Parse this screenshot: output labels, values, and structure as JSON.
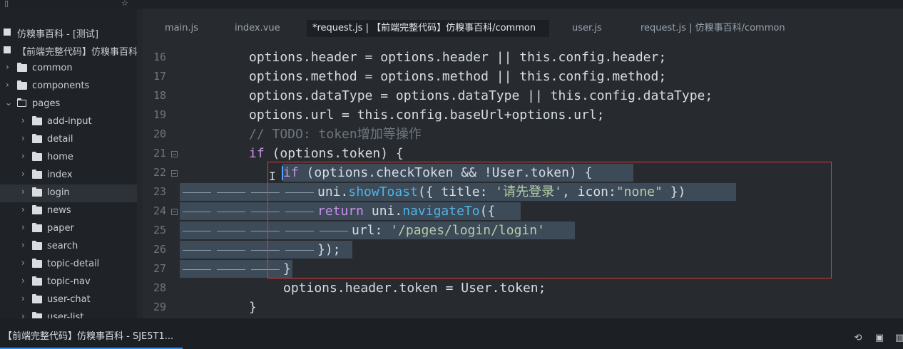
{
  "sidebar": {
    "projects": [
      {
        "label": "仿糗事百科 - [测试]"
      },
      {
        "label": "【前端完整代码】仿糗事百科"
      }
    ],
    "items": [
      {
        "label": "common",
        "expanded": false
      },
      {
        "label": "components",
        "expanded": false
      },
      {
        "label": "pages",
        "expanded": true
      },
      {
        "label": "add-input",
        "expanded": false
      },
      {
        "label": "detail",
        "expanded": false
      },
      {
        "label": "home",
        "expanded": false
      },
      {
        "label": "index",
        "expanded": false
      },
      {
        "label": "login",
        "expanded": false,
        "selected": true
      },
      {
        "label": "news",
        "expanded": false
      },
      {
        "label": "paper",
        "expanded": false
      },
      {
        "label": "search",
        "expanded": false
      },
      {
        "label": "topic-detail",
        "expanded": false
      },
      {
        "label": "topic-nav",
        "expanded": false
      },
      {
        "label": "user-chat",
        "expanded": false
      },
      {
        "label": "user-list",
        "expanded": false
      }
    ]
  },
  "tabs": [
    {
      "label": "main.js",
      "active": false
    },
    {
      "label": "index.vue",
      "active": false
    },
    {
      "label": "*request.js | 【前端完整代码】仿糗事百科/common",
      "active": true
    },
    {
      "label": "user.js",
      "active": false
    },
    {
      "label": "request.js | 仿糗事百科/common",
      "active": false
    }
  ],
  "editor": {
    "line_numbers": [
      "16",
      "17",
      "18",
      "19",
      "20",
      "21",
      "22",
      "23",
      "24",
      "25",
      "26",
      "27",
      "28",
      "29"
    ],
    "lines": {
      "l16": "options.header = options.header || this.config.header;",
      "l17": "options.method = options.method || this.config.method;",
      "l18": "options.dataType = options.dataType || this.config.dataType;",
      "l19": "options.url = this.config.baseUrl+options.url;",
      "l20": "// TODO: token增加等操作",
      "l21_kw": "if",
      "l21_rest": " (options.token) {",
      "l22_kw": "if",
      "l22_rest": " (options.checkToken && !User.token) {",
      "l23_a": "uni.",
      "l23_fn": "showToast",
      "l23_b": "({ title: ",
      "l23_str1": "'请先登录'",
      "l23_c": ", icon:",
      "l23_str2": "\"none\"",
      "l23_d": " })",
      "l24_kw": "return",
      "l24_a": " uni.",
      "l24_fn": "navigateTo",
      "l24_b": "({",
      "l25_a": "url: ",
      "l25_str": "'/pages/login/login'",
      "l26": "});",
      "l27": "}",
      "l28": "options.header.token = User.token;",
      "l29": "}"
    }
  },
  "statusbar": {
    "project_tab": "【前端完整代码】仿糗事百科 - SJE5T1..."
  },
  "colors": {
    "accent": "#2d8cf0",
    "highlight_box": "#e03a3a",
    "keyword": "#c792ea",
    "function": "#4fb3e8",
    "string": "#b5cea8"
  }
}
